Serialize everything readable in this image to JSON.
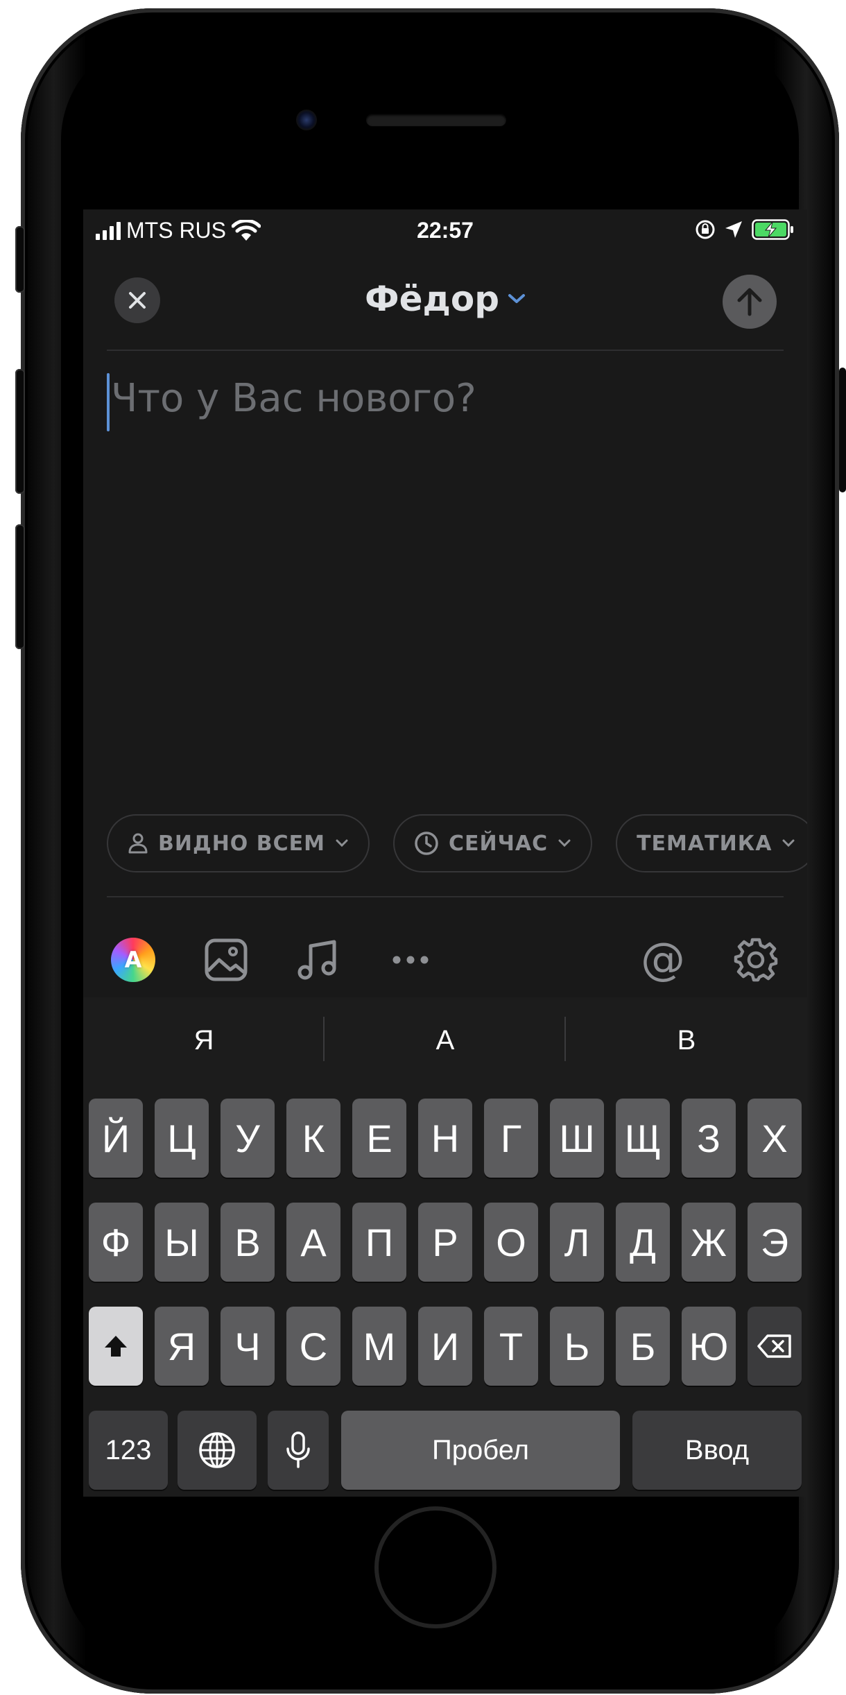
{
  "status_bar": {
    "carrier": "MTS RUS",
    "time": "22:57",
    "icons": [
      "signal-icon",
      "wifi-icon",
      "orientation-lock-icon",
      "location-arrow-icon",
      "battery-charging-icon"
    ]
  },
  "header": {
    "title": "Фёдор",
    "close_icon": "close-icon",
    "send_icon": "arrow-up-icon"
  },
  "composer": {
    "placeholder": "Что у Вас нового?"
  },
  "chips": [
    {
      "label": "ВИДНО ВСЕМ",
      "icon": "person-icon"
    },
    {
      "label": "СЕЙЧАС",
      "icon": "clock-icon"
    },
    {
      "label": "ТЕМАТИКА"
    }
  ],
  "toolbar": {
    "avatar_letter": "A",
    "icons": [
      "text-style-icon",
      "image-icon",
      "music-icon",
      "more-icon",
      "mention-icon",
      "settings-icon"
    ],
    "mention_symbol": "@"
  },
  "keyboard": {
    "suggestions": [
      "Я",
      "А",
      "В"
    ],
    "row1": [
      "Й",
      "Ц",
      "У",
      "К",
      "Е",
      "Н",
      "Г",
      "Ш",
      "Щ",
      "З",
      "Х"
    ],
    "row2": [
      "Ф",
      "Ы",
      "В",
      "А",
      "П",
      "Р",
      "О",
      "Л",
      "Д",
      "Ж",
      "Э"
    ],
    "row3": [
      "Я",
      "Ч",
      "С",
      "М",
      "И",
      "Т",
      "Ь",
      "Б",
      "Ю"
    ],
    "numbers_label": "123",
    "space_label": "Пробел",
    "return_label": "Ввод"
  },
  "colors": {
    "background": "#191919",
    "accent": "#5d91d6",
    "chip_text": "#8e9094",
    "key": "#5c5c5e",
    "key_dark": "#3b3b3d"
  }
}
